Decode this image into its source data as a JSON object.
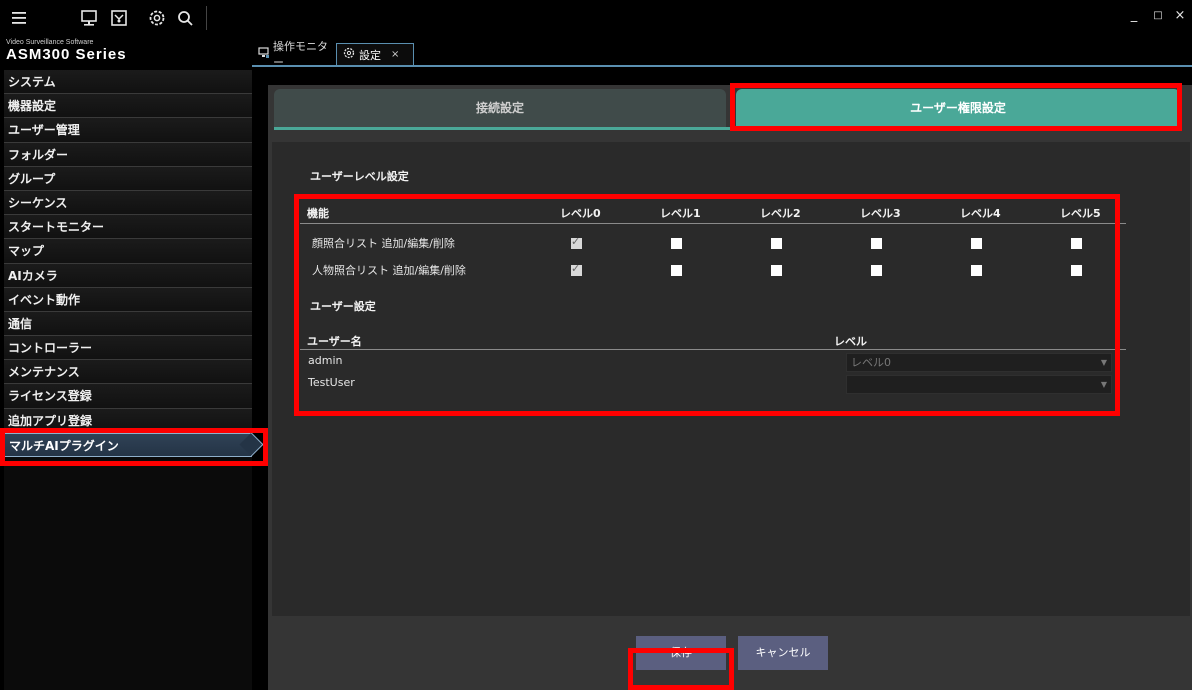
{
  "app": {
    "brand_sub": "Video Surveillance Software",
    "brand_main": "ASM300 Series"
  },
  "window": {
    "minimize": "_",
    "maximize": "□",
    "close": "×"
  },
  "tabs": [
    {
      "label": "操作モニター"
    },
    {
      "label": "設定",
      "close": "×"
    }
  ],
  "sidebar": {
    "items": [
      {
        "label": "システム"
      },
      {
        "label": "機器設定"
      },
      {
        "label": "ユーザー管理"
      },
      {
        "label": "フォルダー"
      },
      {
        "label": "グループ"
      },
      {
        "label": "シーケンス"
      },
      {
        "label": "スタートモニター"
      },
      {
        "label": "マップ"
      },
      {
        "label": "AIカメラ"
      },
      {
        "label": "イベント動作"
      },
      {
        "label": "通信"
      },
      {
        "label": "コントローラー"
      },
      {
        "label": "メンテナンス"
      },
      {
        "label": "ライセンス登録"
      },
      {
        "label": "追加アプリ登録"
      },
      {
        "label": "マルチAIプラグイン",
        "active": true
      }
    ]
  },
  "subtabs": {
    "connection": "接続設定",
    "user_permission": "ユーザー権限設定"
  },
  "level_settings": {
    "title": "ユーザーレベル設定",
    "headers": [
      "機能",
      "レベル0",
      "レベル1",
      "レベル2",
      "レベル3",
      "レベル4",
      "レベル5"
    ],
    "rows": [
      {
        "label": "顔照合リスト 追加/編集/削除",
        "levels": [
          true,
          false,
          false,
          false,
          false,
          false
        ]
      },
      {
        "label": "人物照合リスト 追加/編集/削除",
        "levels": [
          true,
          false,
          false,
          false,
          false,
          false
        ]
      }
    ]
  },
  "user_settings": {
    "title": "ユーザー設定",
    "headers": {
      "name": "ユーザー名",
      "level": "レベル"
    },
    "users": [
      {
        "name": "admin",
        "level": "レベル0"
      },
      {
        "name": "TestUser",
        "level": ""
      }
    ]
  },
  "footer": {
    "save": "保存",
    "cancel": "キャンセル"
  },
  "colors": {
    "accent_teal": "#4aa898",
    "highlight_red": "#ff0000",
    "button": "#5b5f80"
  }
}
